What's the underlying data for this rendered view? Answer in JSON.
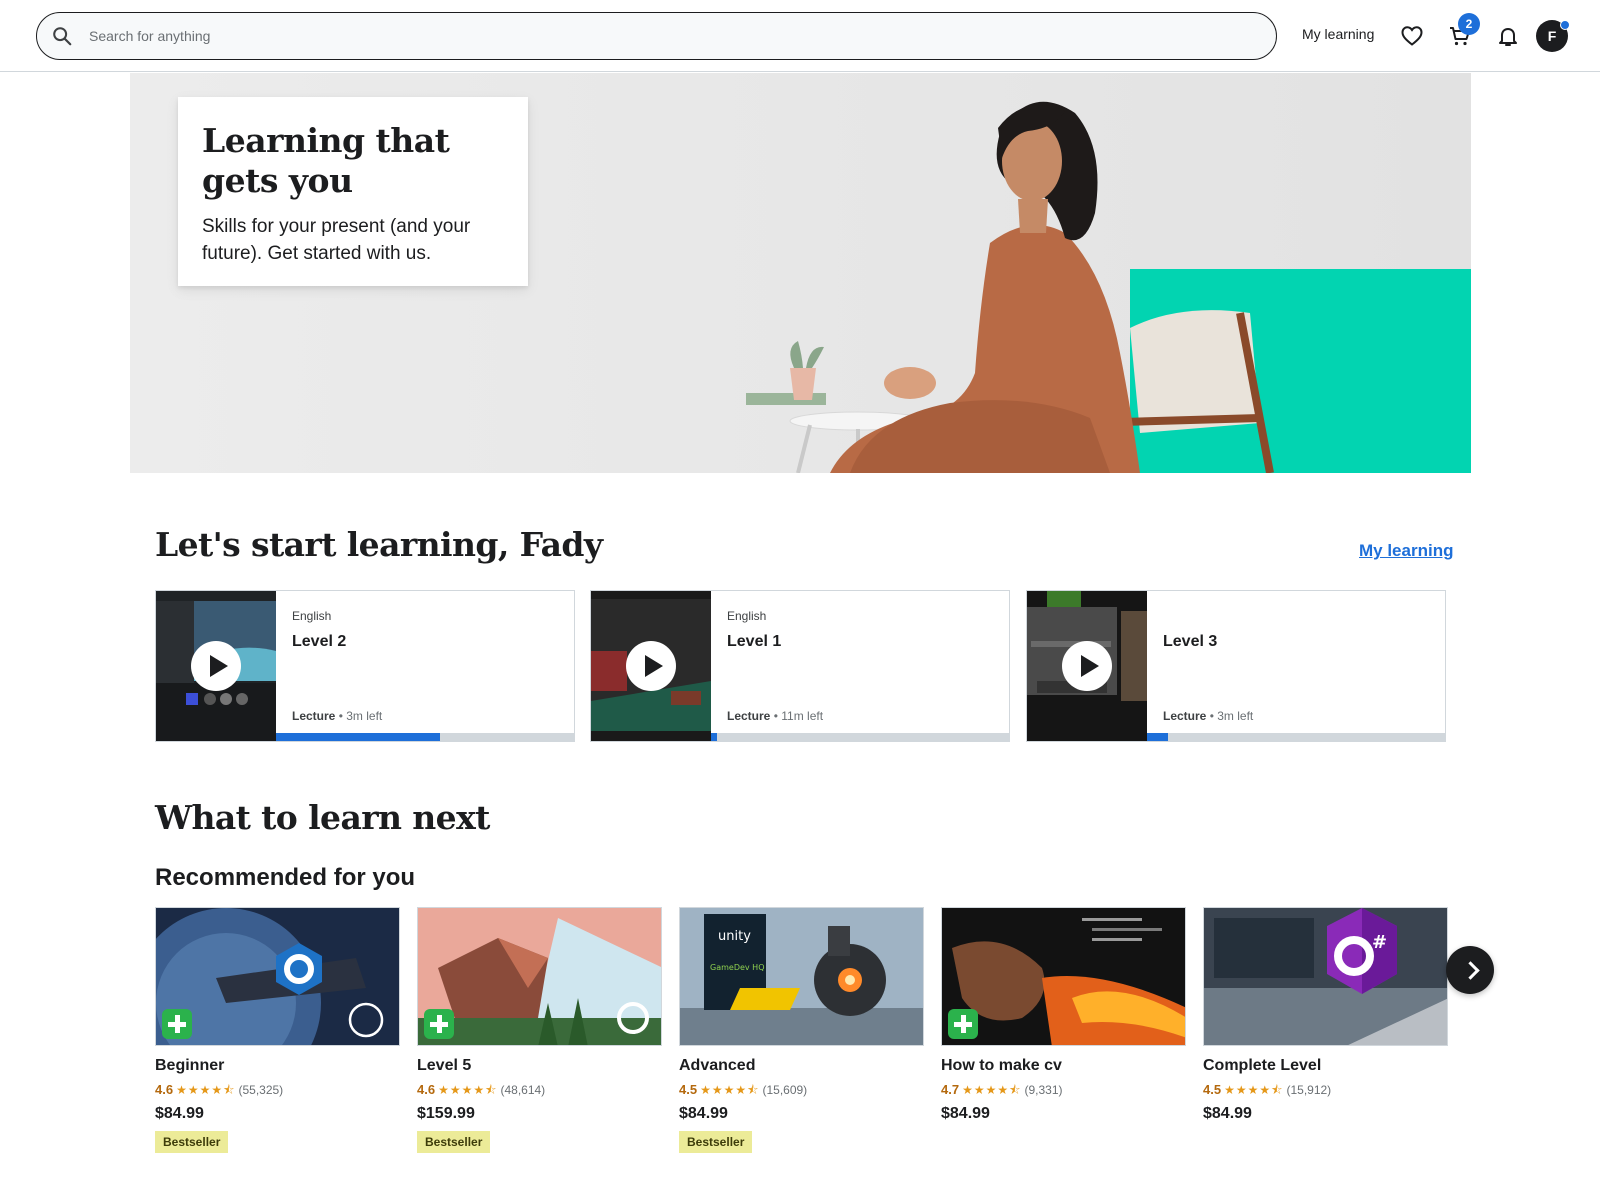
{
  "header": {
    "search_placeholder": "Search for anything",
    "my_learning": "My learning",
    "cart_count": "2",
    "avatar_initial": "F",
    "icons": [
      "search-icon",
      "heart-icon",
      "cart-icon",
      "bell-icon"
    ]
  },
  "hero": {
    "title": "Learning that gets you",
    "subtitle": "Skills for your present (and your future). Get started with us."
  },
  "start_learning": {
    "heading": "Let's start learning, Fady",
    "link": "My learning",
    "lectures": [
      {
        "language": "English",
        "title": "Level 2",
        "type": "Lecture",
        "time_left": "3m left",
        "progress": 0.55
      },
      {
        "language": "English",
        "title": "Level 1",
        "type": "Lecture",
        "time_left": "11m left",
        "progress": 0.02
      },
      {
        "language": "",
        "title": "Level 3",
        "type": "Lecture",
        "time_left": "3m left",
        "progress": 0.07
      }
    ]
  },
  "next": {
    "heading": "What to learn next",
    "subheading": "Recommended for you",
    "courses": [
      {
        "title": "Beginner",
        "rating": "4.6",
        "rating_value": 4.6,
        "reviews": "(55,325)",
        "price": "$84.99",
        "badge": "Bestseller"
      },
      {
        "title": "Level 5",
        "rating": "4.6",
        "rating_value": 4.6,
        "reviews": "(48,614)",
        "price": "$159.99",
        "badge": "Bestseller"
      },
      {
        "title": "Advanced",
        "rating": "4.5",
        "rating_value": 4.5,
        "reviews": "(15,609)",
        "price": "$84.99",
        "badge": "Bestseller"
      },
      {
        "title": "How to make cv",
        "rating": "4.7",
        "rating_value": 4.7,
        "reviews": "(9,331)",
        "price": "$84.99",
        "badge": ""
      },
      {
        "title": "Complete Level",
        "rating": "4.5",
        "rating_value": 4.5,
        "reviews": "(15,912)",
        "price": "$84.99",
        "badge": ""
      }
    ],
    "thumb_labels": [
      "unity",
      "GameDev HQ"
    ]
  },
  "colors": {
    "accent_blue": "#1e6fd9",
    "hero_teal": "#02d4b1",
    "rating_orange": "#b4690e",
    "star": "#e59819",
    "badge_bg": "#eceb98",
    "plus_green": "#2bb24c"
  }
}
